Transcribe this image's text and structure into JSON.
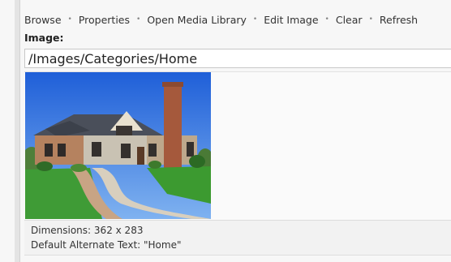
{
  "toolbar": {
    "browse_label": "Browse",
    "properties_label": "Properties",
    "open_media_library_label": "Open Media Library",
    "edit_image_label": "Edit Image",
    "clear_label": "Clear",
    "refresh_label": "Refresh",
    "separator": "•"
  },
  "field": {
    "label": "Image:",
    "path_value": "/Images/Categories/Home"
  },
  "info": {
    "dimensions_label": "Dimensions:",
    "dimensions_value": "362 x 283",
    "alt_text_label": "Default Alternate Text:",
    "alt_text_value": "\"Home\""
  }
}
